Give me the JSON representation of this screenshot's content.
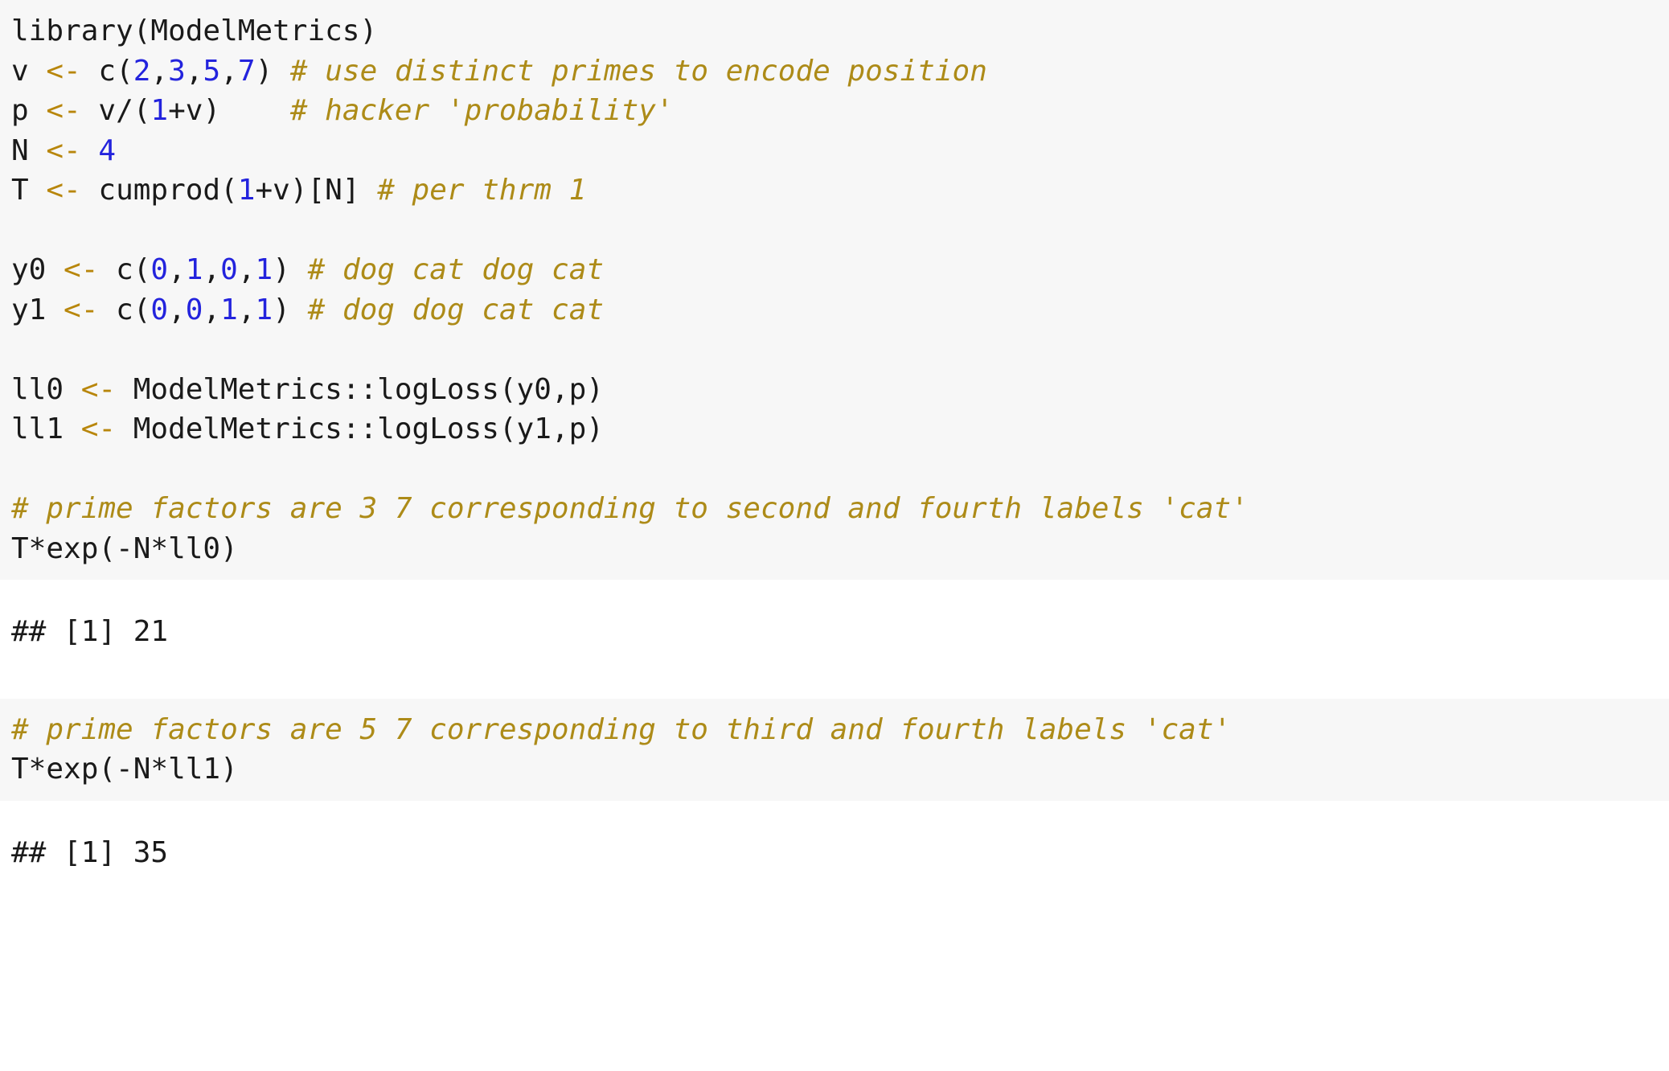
{
  "document": {
    "kind": "rmarkdown-knitr-code-output",
    "background": "#ffffff",
    "code_block_background": "#f7f7f7",
    "comment_color": "#ad8b18",
    "number_color": "#2323dd",
    "operator_color": "#b8860b",
    "text_color": "#1a1a1a",
    "language": "R"
  },
  "chunks": [
    {
      "type": "source",
      "lines": [
        [
          {
            "t": "library(ModelMetrics)",
            "c": "plain"
          }
        ],
        [
          {
            "t": "v ",
            "c": "plain"
          },
          {
            "t": "<-",
            "c": "op"
          },
          {
            "t": " c(",
            "c": "plain"
          },
          {
            "t": "2",
            "c": "num"
          },
          {
            "t": ",",
            "c": "plain"
          },
          {
            "t": "3",
            "c": "num"
          },
          {
            "t": ",",
            "c": "plain"
          },
          {
            "t": "5",
            "c": "num"
          },
          {
            "t": ",",
            "c": "plain"
          },
          {
            "t": "7",
            "c": "num"
          },
          {
            "t": ") ",
            "c": "plain"
          },
          {
            "t": "# use distinct primes to encode position",
            "c": "com"
          }
        ],
        [
          {
            "t": "p ",
            "c": "plain"
          },
          {
            "t": "<-",
            "c": "op"
          },
          {
            "t": " v/(",
            "c": "plain"
          },
          {
            "t": "1",
            "c": "num"
          },
          {
            "t": "+v)    ",
            "c": "plain"
          },
          {
            "t": "# hacker 'probability'",
            "c": "com"
          }
        ],
        [
          {
            "t": "N ",
            "c": "plain"
          },
          {
            "t": "<-",
            "c": "op"
          },
          {
            "t": " ",
            "c": "plain"
          },
          {
            "t": "4",
            "c": "num"
          }
        ],
        [
          {
            "t": "T ",
            "c": "plain"
          },
          {
            "t": "<-",
            "c": "op"
          },
          {
            "t": " cumprod(",
            "c": "plain"
          },
          {
            "t": "1",
            "c": "num"
          },
          {
            "t": "+v)[N] ",
            "c": "plain"
          },
          {
            "t": "# per thrm 1",
            "c": "com"
          }
        ],
        [
          {
            "t": "",
            "c": "plain"
          }
        ],
        [
          {
            "t": "y0 ",
            "c": "plain"
          },
          {
            "t": "<-",
            "c": "op"
          },
          {
            "t": " c(",
            "c": "plain"
          },
          {
            "t": "0",
            "c": "num"
          },
          {
            "t": ",",
            "c": "plain"
          },
          {
            "t": "1",
            "c": "num"
          },
          {
            "t": ",",
            "c": "plain"
          },
          {
            "t": "0",
            "c": "num"
          },
          {
            "t": ",",
            "c": "plain"
          },
          {
            "t": "1",
            "c": "num"
          },
          {
            "t": ") ",
            "c": "plain"
          },
          {
            "t": "# dog cat dog cat",
            "c": "com"
          }
        ],
        [
          {
            "t": "y1 ",
            "c": "plain"
          },
          {
            "t": "<-",
            "c": "op"
          },
          {
            "t": " c(",
            "c": "plain"
          },
          {
            "t": "0",
            "c": "num"
          },
          {
            "t": ",",
            "c": "plain"
          },
          {
            "t": "0",
            "c": "num"
          },
          {
            "t": ",",
            "c": "plain"
          },
          {
            "t": "1",
            "c": "num"
          },
          {
            "t": ",",
            "c": "plain"
          },
          {
            "t": "1",
            "c": "num"
          },
          {
            "t": ") ",
            "c": "plain"
          },
          {
            "t": "# dog dog cat cat",
            "c": "com"
          }
        ],
        [
          {
            "t": "",
            "c": "plain"
          }
        ],
        [
          {
            "t": "ll0 ",
            "c": "plain"
          },
          {
            "t": "<-",
            "c": "op"
          },
          {
            "t": " ModelMetrics::logLoss(y0,p)",
            "c": "plain"
          }
        ],
        [
          {
            "t": "ll1 ",
            "c": "plain"
          },
          {
            "t": "<-",
            "c": "op"
          },
          {
            "t": " ModelMetrics::logLoss(y1,p)",
            "c": "plain"
          }
        ],
        [
          {
            "t": "",
            "c": "plain"
          }
        ],
        [
          {
            "t": "# prime factors are 3 7 corresponding to second and fourth labels 'cat'",
            "c": "com"
          }
        ],
        [
          {
            "t": "T*exp(-N*ll0)",
            "c": "plain"
          }
        ]
      ]
    },
    {
      "type": "output",
      "lines": [
        [
          {
            "t": "## [1] 21",
            "c": "plain"
          }
        ]
      ]
    },
    {
      "type": "source",
      "lines": [
        [
          {
            "t": "# prime factors are 5 7 corresponding to third and fourth labels 'cat'",
            "c": "com"
          }
        ],
        [
          {
            "t": "T*exp(-N*ll1)",
            "c": "plain"
          }
        ]
      ]
    },
    {
      "type": "output",
      "lines": [
        [
          {
            "t": "## [1] 35",
            "c": "plain"
          }
        ]
      ]
    }
  ]
}
